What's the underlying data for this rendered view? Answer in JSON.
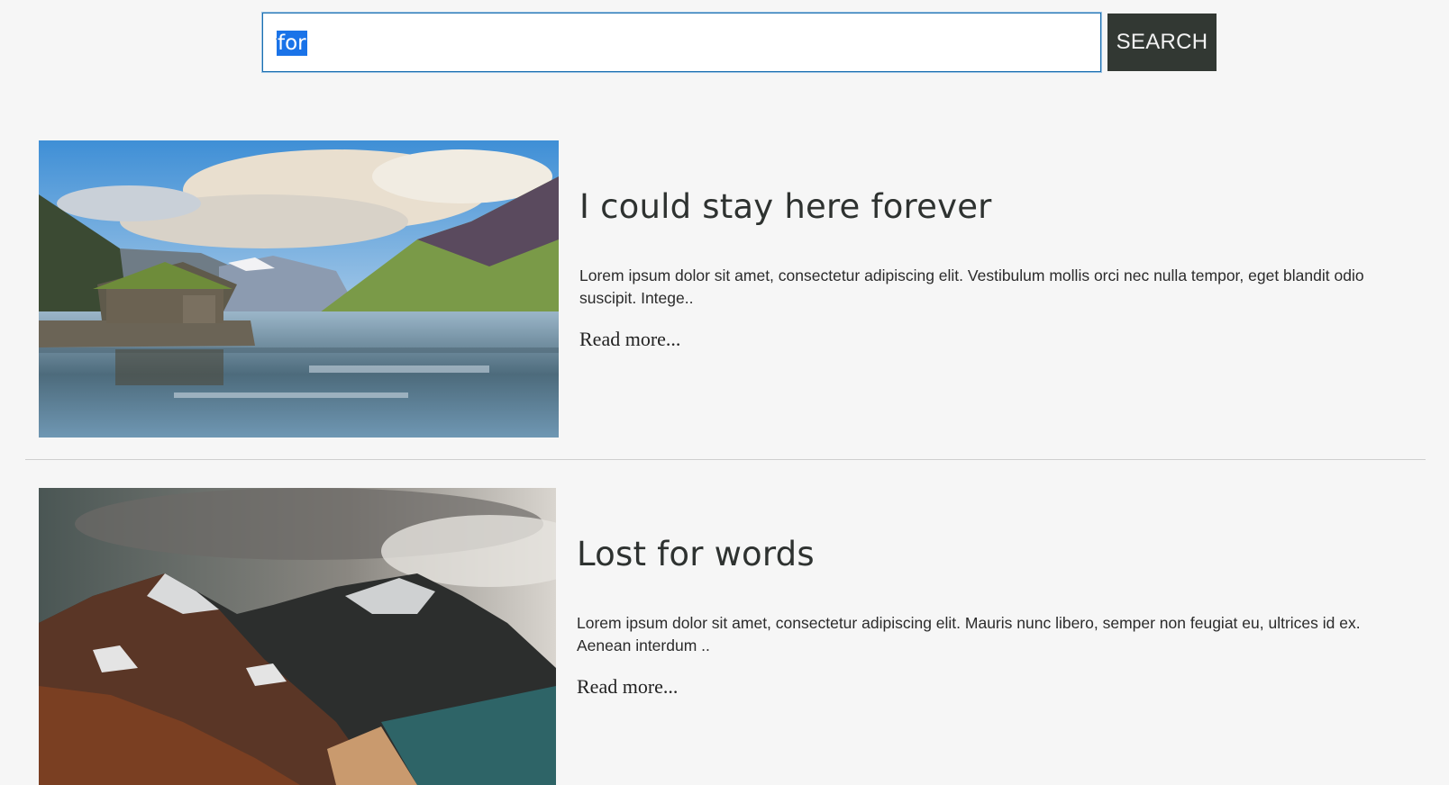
{
  "search": {
    "value": "for",
    "button_label": "SEARCH"
  },
  "articles": [
    {
      "title": "I could stay here forever",
      "excerpt": "Lorem ipsum dolor sit amet, consectetur adipiscing elit. Vestibulum mollis orci nec nulla tempor, eget blandit odio suscipit. Intege..",
      "read_more": "Read more..."
    },
    {
      "title": "Lost for words",
      "excerpt": "Lorem ipsum dolor sit amet, consectetur adipiscing elit. Mauris nunc libero, semper non feugiat eu, ultrices id ex. Aenean interdum ..",
      "read_more": "Read more..."
    }
  ],
  "colors": {
    "background": "#f6f6f6",
    "search_border": "#1a6fb0",
    "selection": "#1a73e8",
    "button_bg": "#323833",
    "divider": "#cfcfcf"
  }
}
